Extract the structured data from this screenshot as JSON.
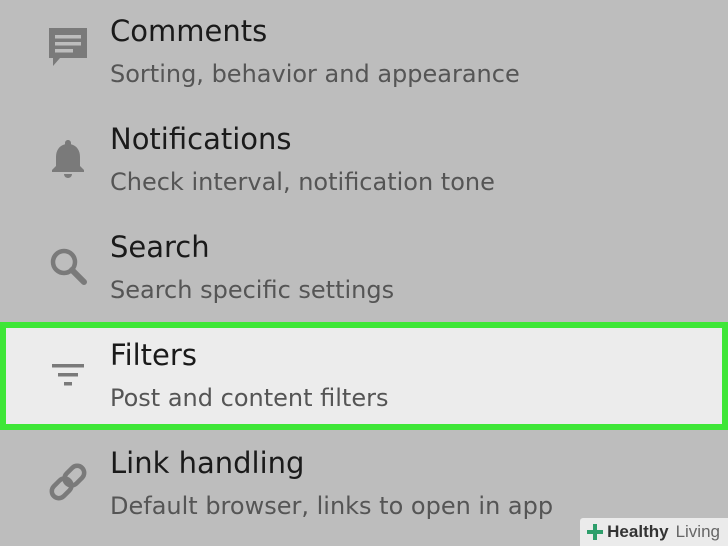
{
  "settings": {
    "items": [
      {
        "icon": "comment-icon",
        "title": "Comments",
        "subtitle": "Sorting, behavior and appearance"
      },
      {
        "icon": "bell-icon",
        "title": "Notifications",
        "subtitle": "Check interval, notification tone"
      },
      {
        "icon": "search-icon",
        "title": "Search",
        "subtitle": "Search specific settings"
      },
      {
        "icon": "filter-icon",
        "title": "Filters",
        "subtitle": "Post and content filters",
        "highlighted": true
      },
      {
        "icon": "link-icon",
        "title": "Link handling",
        "subtitle": "Default browser, links to open in app"
      }
    ]
  },
  "watermark": {
    "brand_bold": "Healthy",
    "brand_light": "Living",
    "logo": "green-cross-icon"
  },
  "colors": {
    "background": "#bdbdbd",
    "highlight_background": "#ececec",
    "highlight_border": "#3ee637",
    "icon": "#7a7a7a",
    "title": "#1a1a1a",
    "subtitle": "#555555",
    "logo": "#2e9e6b"
  }
}
